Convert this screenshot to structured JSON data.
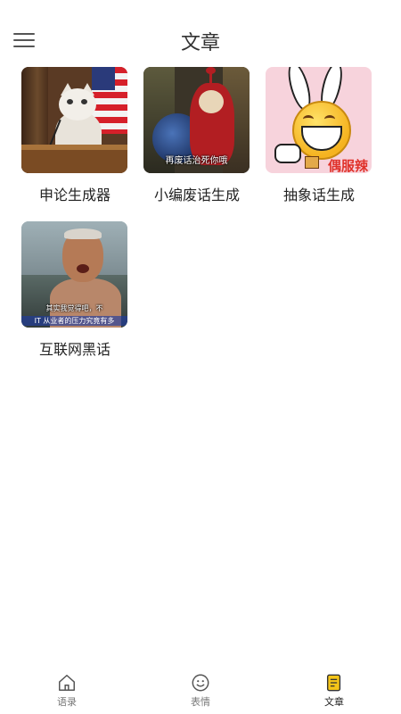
{
  "header": {
    "title": "文章"
  },
  "articles": [
    {
      "label": "申论生成器"
    },
    {
      "label": "小编废话生成",
      "thumb_caption": "再废话治死你哦"
    },
    {
      "label": "抽象话生成",
      "thumb_caption": "偶服辣"
    },
    {
      "label": "互联网黑话",
      "thumb_caption_1": "其实我觉得吧，不",
      "thumb_caption_2": "IT 从业者的压力究竟有多"
    }
  ],
  "nav": {
    "items": [
      {
        "label": "语录",
        "icon": "home-icon",
        "active": false
      },
      {
        "label": "表情",
        "icon": "smile-icon",
        "active": false
      },
      {
        "label": "文章",
        "icon": "article-icon",
        "active": true
      }
    ],
    "active_color": "#f5c518"
  }
}
